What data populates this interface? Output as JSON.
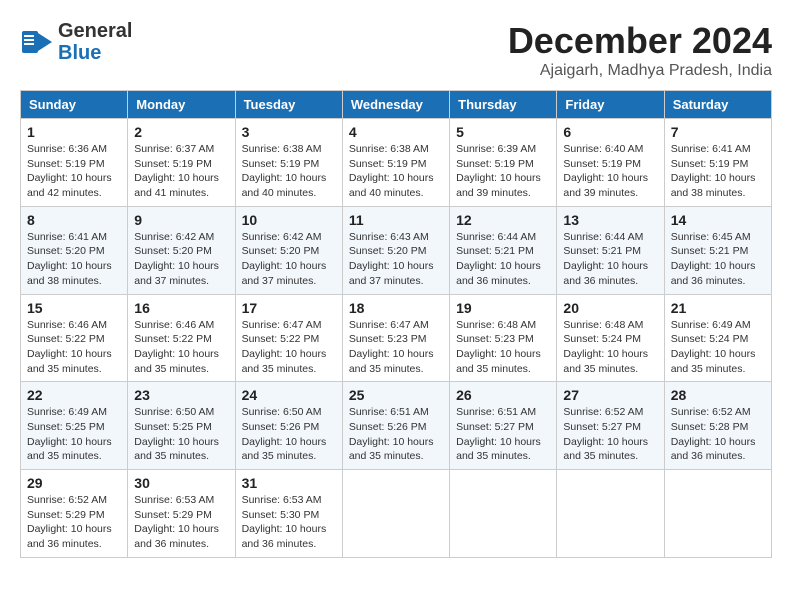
{
  "logo": {
    "line1": "General",
    "line2": "Blue"
  },
  "title": {
    "month": "December 2024",
    "location": "Ajaigarh, Madhya Pradesh, India"
  },
  "headers": [
    "Sunday",
    "Monday",
    "Tuesday",
    "Wednesday",
    "Thursday",
    "Friday",
    "Saturday"
  ],
  "weeks": [
    [
      {
        "day": "1",
        "info": "Sunrise: 6:36 AM\nSunset: 5:19 PM\nDaylight: 10 hours and 42 minutes."
      },
      {
        "day": "2",
        "info": "Sunrise: 6:37 AM\nSunset: 5:19 PM\nDaylight: 10 hours and 41 minutes."
      },
      {
        "day": "3",
        "info": "Sunrise: 6:38 AM\nSunset: 5:19 PM\nDaylight: 10 hours and 40 minutes."
      },
      {
        "day": "4",
        "info": "Sunrise: 6:38 AM\nSunset: 5:19 PM\nDaylight: 10 hours and 40 minutes."
      },
      {
        "day": "5",
        "info": "Sunrise: 6:39 AM\nSunset: 5:19 PM\nDaylight: 10 hours and 39 minutes."
      },
      {
        "day": "6",
        "info": "Sunrise: 6:40 AM\nSunset: 5:19 PM\nDaylight: 10 hours and 39 minutes."
      },
      {
        "day": "7",
        "info": "Sunrise: 6:41 AM\nSunset: 5:19 PM\nDaylight: 10 hours and 38 minutes."
      }
    ],
    [
      {
        "day": "8",
        "info": "Sunrise: 6:41 AM\nSunset: 5:20 PM\nDaylight: 10 hours and 38 minutes."
      },
      {
        "day": "9",
        "info": "Sunrise: 6:42 AM\nSunset: 5:20 PM\nDaylight: 10 hours and 37 minutes."
      },
      {
        "day": "10",
        "info": "Sunrise: 6:42 AM\nSunset: 5:20 PM\nDaylight: 10 hours and 37 minutes."
      },
      {
        "day": "11",
        "info": "Sunrise: 6:43 AM\nSunset: 5:20 PM\nDaylight: 10 hours and 37 minutes."
      },
      {
        "day": "12",
        "info": "Sunrise: 6:44 AM\nSunset: 5:21 PM\nDaylight: 10 hours and 36 minutes."
      },
      {
        "day": "13",
        "info": "Sunrise: 6:44 AM\nSunset: 5:21 PM\nDaylight: 10 hours and 36 minutes."
      },
      {
        "day": "14",
        "info": "Sunrise: 6:45 AM\nSunset: 5:21 PM\nDaylight: 10 hours and 36 minutes."
      }
    ],
    [
      {
        "day": "15",
        "info": "Sunrise: 6:46 AM\nSunset: 5:22 PM\nDaylight: 10 hours and 35 minutes."
      },
      {
        "day": "16",
        "info": "Sunrise: 6:46 AM\nSunset: 5:22 PM\nDaylight: 10 hours and 35 minutes."
      },
      {
        "day": "17",
        "info": "Sunrise: 6:47 AM\nSunset: 5:22 PM\nDaylight: 10 hours and 35 minutes."
      },
      {
        "day": "18",
        "info": "Sunrise: 6:47 AM\nSunset: 5:23 PM\nDaylight: 10 hours and 35 minutes."
      },
      {
        "day": "19",
        "info": "Sunrise: 6:48 AM\nSunset: 5:23 PM\nDaylight: 10 hours and 35 minutes."
      },
      {
        "day": "20",
        "info": "Sunrise: 6:48 AM\nSunset: 5:24 PM\nDaylight: 10 hours and 35 minutes."
      },
      {
        "day": "21",
        "info": "Sunrise: 6:49 AM\nSunset: 5:24 PM\nDaylight: 10 hours and 35 minutes."
      }
    ],
    [
      {
        "day": "22",
        "info": "Sunrise: 6:49 AM\nSunset: 5:25 PM\nDaylight: 10 hours and 35 minutes."
      },
      {
        "day": "23",
        "info": "Sunrise: 6:50 AM\nSunset: 5:25 PM\nDaylight: 10 hours and 35 minutes."
      },
      {
        "day": "24",
        "info": "Sunrise: 6:50 AM\nSunset: 5:26 PM\nDaylight: 10 hours and 35 minutes."
      },
      {
        "day": "25",
        "info": "Sunrise: 6:51 AM\nSunset: 5:26 PM\nDaylight: 10 hours and 35 minutes."
      },
      {
        "day": "26",
        "info": "Sunrise: 6:51 AM\nSunset: 5:27 PM\nDaylight: 10 hours and 35 minutes."
      },
      {
        "day": "27",
        "info": "Sunrise: 6:52 AM\nSunset: 5:27 PM\nDaylight: 10 hours and 35 minutes."
      },
      {
        "day": "28",
        "info": "Sunrise: 6:52 AM\nSunset: 5:28 PM\nDaylight: 10 hours and 36 minutes."
      }
    ],
    [
      {
        "day": "29",
        "info": "Sunrise: 6:52 AM\nSunset: 5:29 PM\nDaylight: 10 hours and 36 minutes."
      },
      {
        "day": "30",
        "info": "Sunrise: 6:53 AM\nSunset: 5:29 PM\nDaylight: 10 hours and 36 minutes."
      },
      {
        "day": "31",
        "info": "Sunrise: 6:53 AM\nSunset: 5:30 PM\nDaylight: 10 hours and 36 minutes."
      },
      null,
      null,
      null,
      null
    ]
  ]
}
